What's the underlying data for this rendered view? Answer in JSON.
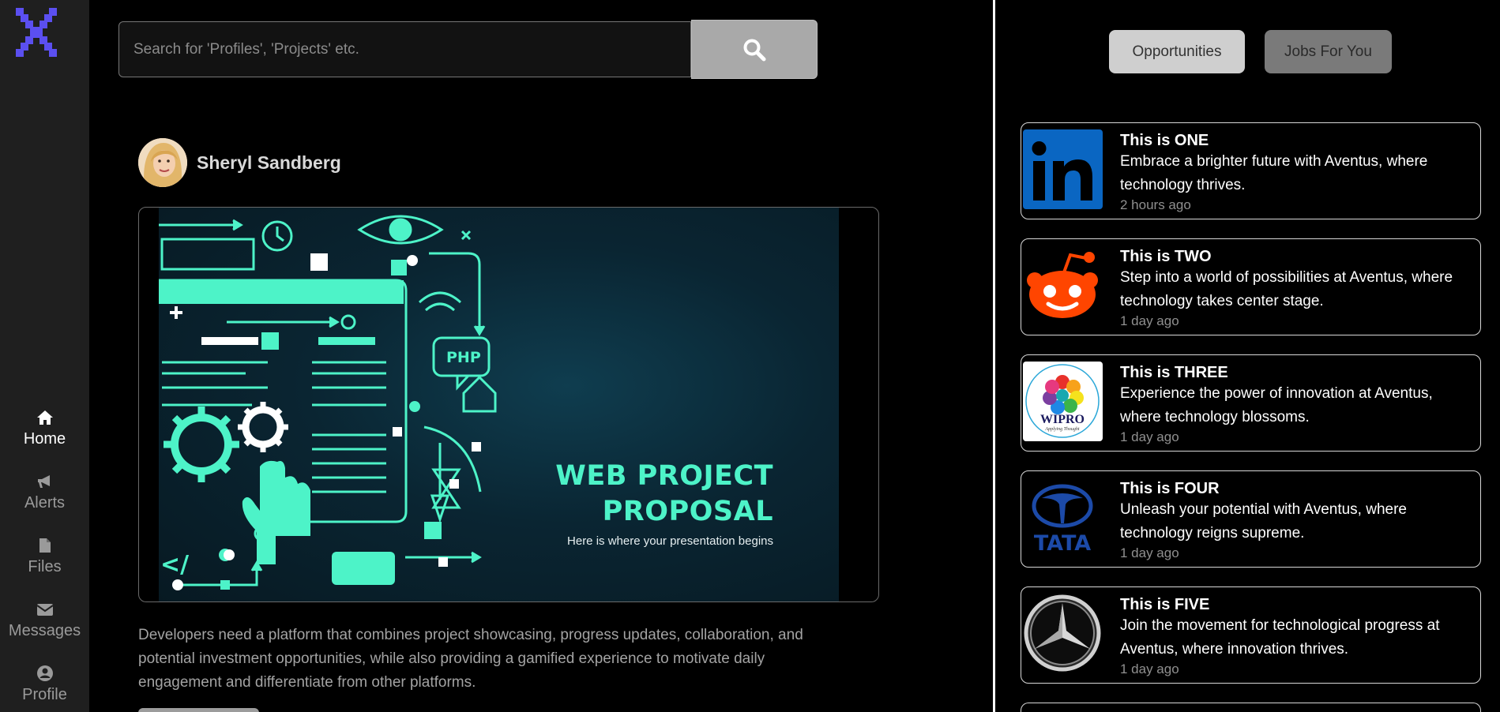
{
  "sidebar": {
    "logo_icon": "x-logo-icon",
    "accent": "#5b4ff0",
    "items": [
      {
        "label": "Home",
        "icon": "home-icon",
        "active": true
      },
      {
        "label": "Alerts",
        "icon": "megaphone-icon",
        "active": false
      },
      {
        "label": "Files",
        "icon": "file-icon",
        "active": false
      },
      {
        "label": "Messages",
        "icon": "envelope-icon",
        "active": false
      },
      {
        "label": "Profile",
        "icon": "user-circle-icon",
        "active": false
      }
    ]
  },
  "search": {
    "placeholder": "Search for 'Profiles', 'Projects' etc.",
    "value": "",
    "button_icon": "search-icon"
  },
  "post": {
    "author": "Sheryl Sandberg",
    "slide": {
      "title_line1": "WEB PROJECT",
      "title_line2": "PROPOSAL",
      "subtitle": "Here is where your presentation begins",
      "php_label": "PHP",
      "code_label": "</"
    },
    "description": "Developers need a platform that combines project showcasing, progress updates, collaboration, and potential investment opportunities, while also providing a gamified experience to motivate daily engagement and differentiate from other platforms."
  },
  "tabs": {
    "opportunities": "Opportunities",
    "jobs": "Jobs For You"
  },
  "feed": [
    {
      "title": "This is ONE",
      "body": "Embrace a brighter future with Aventus, where technology thrives.",
      "time": "2 hours ago",
      "logo": "linkedin-logo"
    },
    {
      "title": "This is TWO",
      "body": "Step into a world of possibilities at Aventus, where technology takes center stage.",
      "time": "1 day ago",
      "logo": "reddit-logo"
    },
    {
      "title": "This is THREE",
      "body": "Experience the power of innovation at Aventus, where technology blossoms.",
      "time": "1 day ago",
      "logo": "wipro-logo",
      "logo_text": "WIPRO",
      "logo_tagline": "Applying Thought"
    },
    {
      "title": "This is FOUR",
      "body": "Unleash your potential with Aventus, where technology reigns supreme.",
      "time": "1 day ago",
      "logo": "tata-logo",
      "logo_text": "TATA"
    },
    {
      "title": "This is FIVE",
      "body": "Join the movement for technological progress at Aventus, where innovation thrives.",
      "time": "1 day ago",
      "logo": "mercedes-logo"
    }
  ],
  "colors": {
    "slide_accent": "#4df3c8",
    "linkedin": "#0a66c2",
    "reddit": "#ff4500",
    "tata": "#1c4aa8"
  }
}
